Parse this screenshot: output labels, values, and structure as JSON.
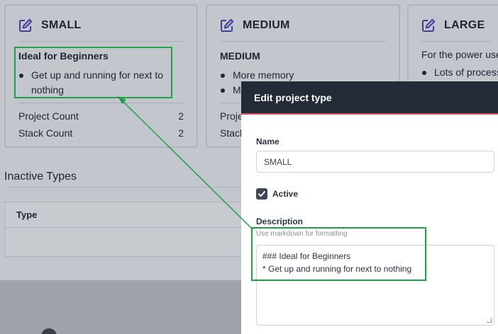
{
  "cards": {
    "small": {
      "title": "SMALL",
      "description_heading": "Ideal for Beginners",
      "bullets": [
        "Get up and running for next to",
        "nothing"
      ],
      "stats": [
        {
          "label": "Project Count",
          "value": "2"
        },
        {
          "label": "Stack Count",
          "value": "2"
        }
      ]
    },
    "medium": {
      "title": "MEDIUM",
      "description_heading": "MEDIUM",
      "bullets": [
        "More memory",
        "M"
      ],
      "stats": [
        {
          "label": "Proje"
        },
        {
          "label": "Stack"
        }
      ]
    },
    "large": {
      "title": "LARGE",
      "description_text": "For the power use",
      "bullets": [
        "Lots of process"
      ]
    }
  },
  "inactive_section": {
    "title": "Inactive Types",
    "table_header": "Type"
  },
  "modal": {
    "title": "Edit project type",
    "name_label": "Name",
    "name_value": "SMALL",
    "active_label": "Active",
    "active_checked": true,
    "description_label": "Description",
    "description_help": "Use markdown for formatting",
    "description_lines": [
      "### Ideal for Beginners",
      "* Get up and running for next to nothing"
    ]
  },
  "colors": {
    "accent_icon": "#3d3f9a",
    "annotation": "#1fa049",
    "modal_header": "#232b38",
    "modal_header_border": "#d9535c"
  },
  "icons": {
    "card": "edit-square-icon",
    "checkbox": "check-icon"
  }
}
